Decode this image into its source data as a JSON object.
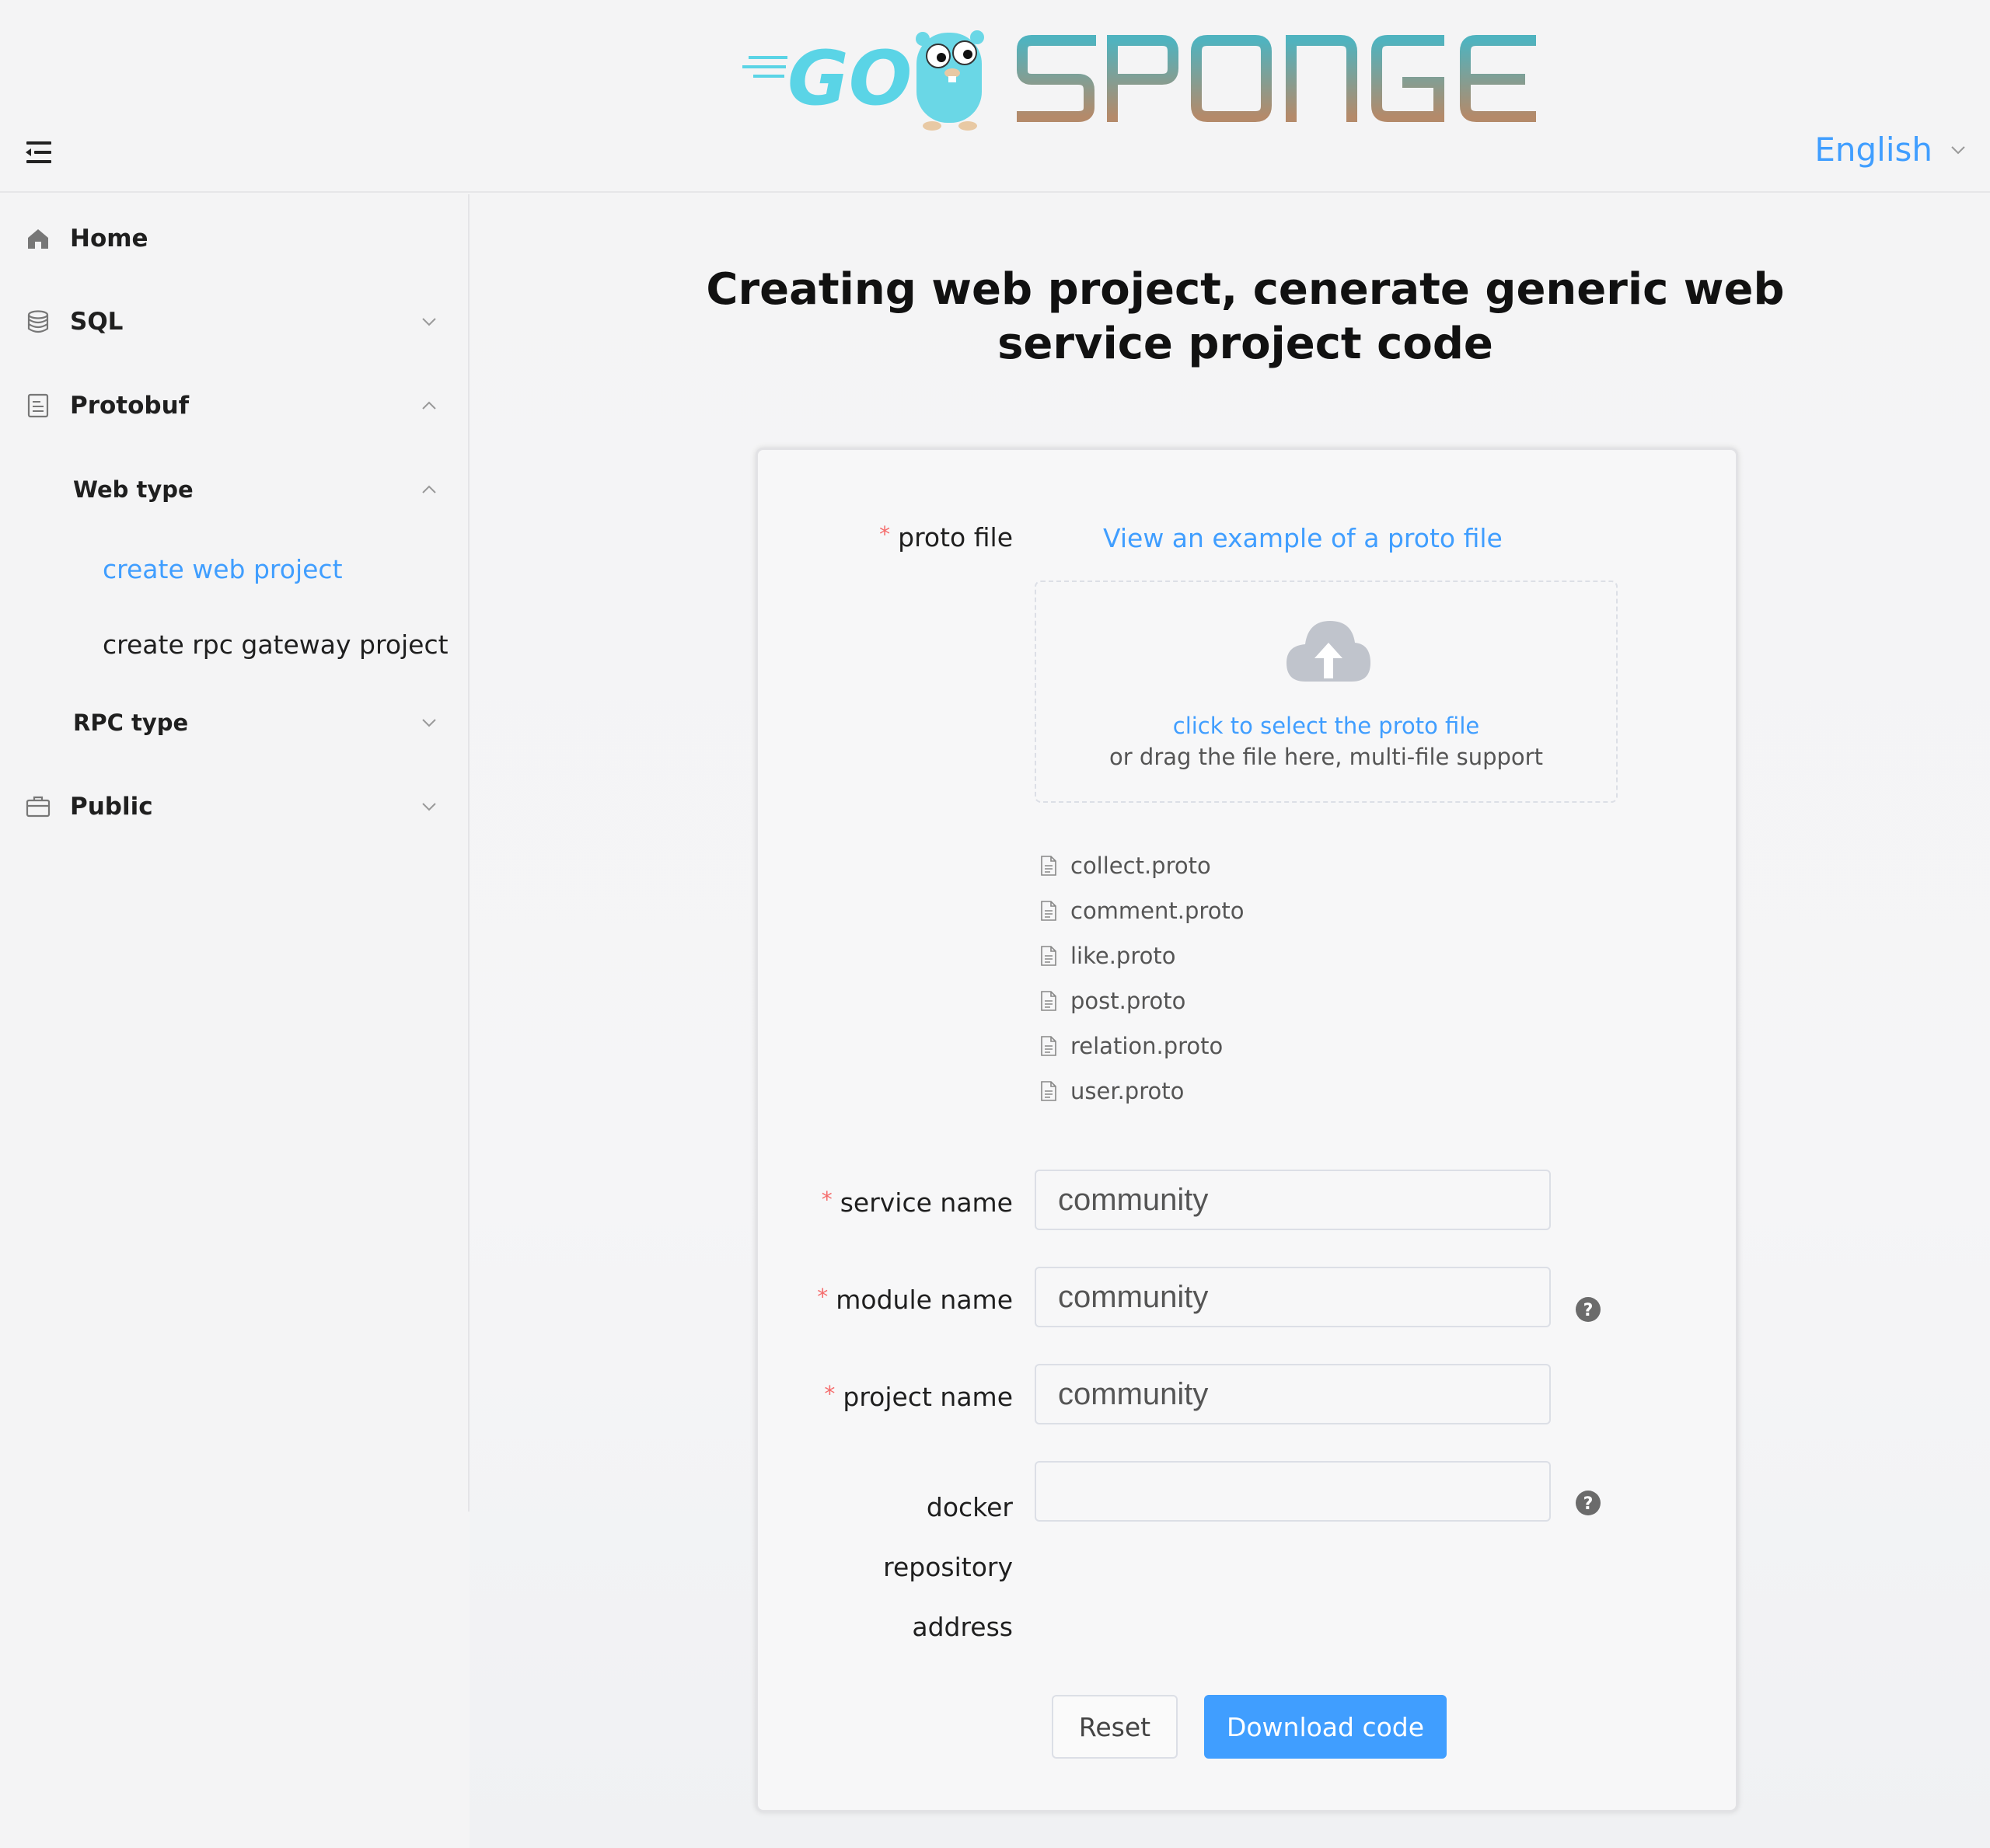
{
  "header": {
    "brand": "GO SPONGE",
    "language": "English"
  },
  "sidebar": {
    "items": [
      {
        "label": "Home",
        "icon": "home-icon"
      },
      {
        "label": "SQL",
        "icon": "database-icon"
      },
      {
        "label": "Protobuf",
        "icon": "document-icon"
      },
      {
        "label": "Web type"
      },
      {
        "label": "create web project"
      },
      {
        "label": "create rpc gateway project"
      },
      {
        "label": "RPC type"
      },
      {
        "label": "Public",
        "icon": "briefcase-icon"
      }
    ]
  },
  "main": {
    "title_line1": "Creating web project, cenerate generic web",
    "title_line2": "service project code"
  },
  "form": {
    "proto_label": "proto file",
    "example_link": "View an example of a proto file",
    "upload_main": "click to select the proto file",
    "upload_sub": "or drag the file here, multi-file support",
    "files": [
      "collect.proto",
      "comment.proto",
      "like.proto",
      "post.proto",
      "relation.proto",
      "user.proto"
    ],
    "service_label": "service name",
    "service_value": "community",
    "module_label": "module name",
    "module_value": "community",
    "project_label": "project name",
    "project_value": "community",
    "docker_label_1": "docker",
    "docker_label_2": "repository",
    "docker_label_3": "address",
    "docker_value": "",
    "reset_label": "Reset",
    "download_label": "Download code"
  },
  "colors": {
    "accent": "#409eff",
    "required": "#f56c6c",
    "background": "#f4f4f5"
  }
}
